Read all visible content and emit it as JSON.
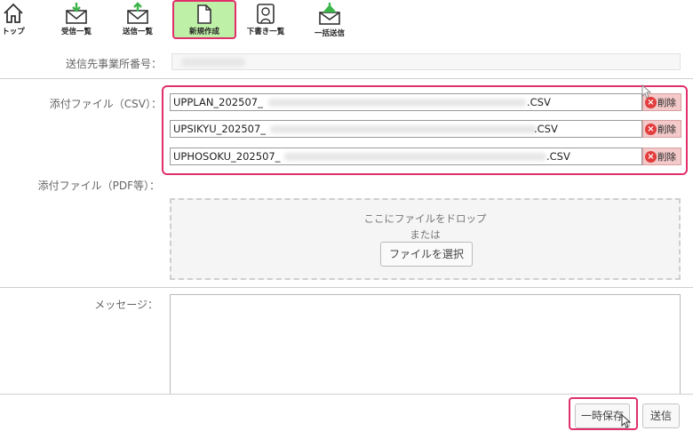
{
  "toolbar": {
    "items": [
      {
        "label": "トップ",
        "icon": "home-icon"
      },
      {
        "label": "受信一覧",
        "icon": "inbox-icon"
      },
      {
        "label": "送信一覧",
        "icon": "outbox-icon"
      },
      {
        "label": "新規作成",
        "icon": "new-document-icon",
        "active": true
      },
      {
        "label": "下書き一覧",
        "icon": "draft-icon"
      },
      {
        "label": "一括送信",
        "icon": "bulk-send-icon"
      }
    ]
  },
  "form": {
    "office_label": "送信先事業所番号：",
    "csv_label": "添付ファイル（CSV）：",
    "csv_files": [
      {
        "prefix": "UPPLAN_202507_",
        "ext": ".CSV",
        "delete_label": "削除"
      },
      {
        "prefix": "UPSIKYU_202507_",
        "ext": ".CSV",
        "delete_label": "削除"
      },
      {
        "prefix": "UPHOSOKU_202507_",
        "ext": ".CSV",
        "delete_label": "削除"
      }
    ],
    "pdf_label": "添付ファイル（PDF等）：",
    "drop_zone": {
      "line1": "ここにファイルをドロップ",
      "line2": "または",
      "choose_label": "ファイルを選択"
    },
    "message_label": "メッセージ："
  },
  "actions": {
    "save_label": "一時保存",
    "send_label": "送信"
  },
  "colors": {
    "highlight": "#e0306a",
    "active_tab": "#bff0a8",
    "icon_green": "#3bb54a",
    "delete_bg": "#f3c9c9"
  }
}
